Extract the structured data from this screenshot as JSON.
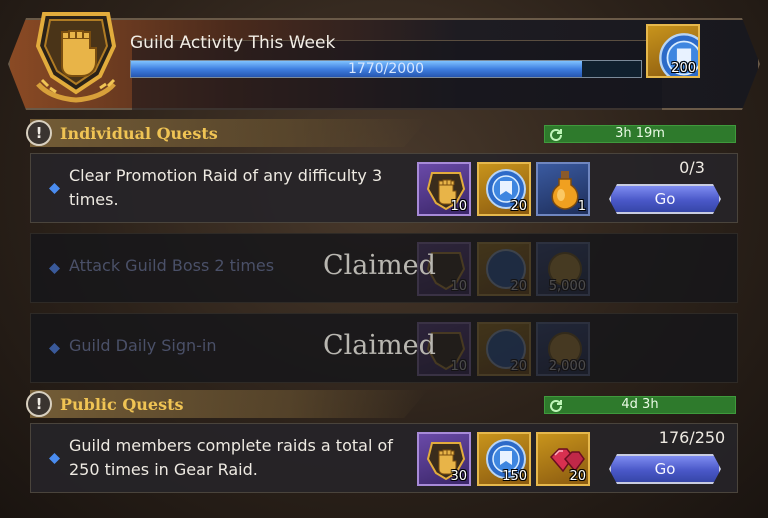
{
  "header": {
    "title": "Guild Activity This Week",
    "progress_text": "1770/2000",
    "progress_fraction": 0.885,
    "chest_qty": "200"
  },
  "individual": {
    "title": "Individual Quests",
    "timer": "3h 19m",
    "quests": [
      {
        "text": "Clear Promotion Raid of any difficulty 3 times.",
        "rewards": [
          {
            "icon": "guild-fist-icon",
            "frame": "purple",
            "qty": "10"
          },
          {
            "icon": "guild-coin-icon",
            "frame": "gold",
            "qty": "20"
          },
          {
            "icon": "potion-icon",
            "frame": "blue",
            "qty": "1"
          }
        ],
        "progress": "0/3",
        "button": "Go"
      },
      {
        "text": "Attack Guild Boss 2 times",
        "status": "Claimed",
        "rewards": [
          {
            "icon": "guild-fist-icon",
            "frame": "purple",
            "qty": "10"
          },
          {
            "icon": "guild-coin-icon",
            "frame": "gold",
            "qty": "20"
          },
          {
            "icon": "gold-coin-icon",
            "frame": "blue",
            "qty": "5,000"
          }
        ]
      },
      {
        "text": "Guild Daily Sign-in",
        "status": "Claimed",
        "rewards": [
          {
            "icon": "guild-fist-icon",
            "frame": "purple",
            "qty": "10"
          },
          {
            "icon": "guild-coin-icon",
            "frame": "gold",
            "qty": "20"
          },
          {
            "icon": "gold-coin-icon",
            "frame": "blue",
            "qty": "2,000"
          }
        ]
      }
    ]
  },
  "public": {
    "title": "Public Quests",
    "timer": "4d 3h",
    "quests": [
      {
        "text": "Guild members complete raids a total of 250 times in Gear Raid.",
        "rewards": [
          {
            "icon": "guild-fist-icon",
            "frame": "purple",
            "qty": "30"
          },
          {
            "icon": "guild-coin-icon",
            "frame": "gold",
            "qty": "150"
          },
          {
            "icon": "ruby-gems-icon",
            "frame": "gold",
            "qty": "20"
          }
        ],
        "progress": "176/250",
        "button": "Go"
      }
    ]
  },
  "colors": {
    "accent_gold": "#f0c454",
    "progress_blue": "#3f7fe0",
    "timer_green": "#2e7a2c",
    "go_button": "#4a58c8"
  }
}
